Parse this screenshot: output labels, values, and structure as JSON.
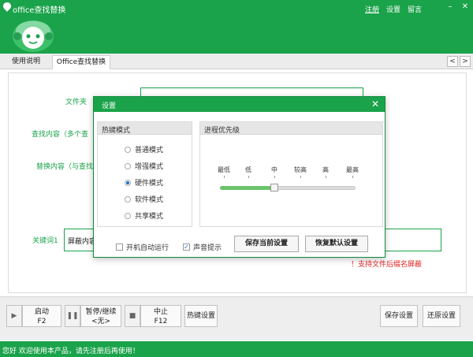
{
  "window": {
    "title": "office查找替换",
    "min_symbol": "–",
    "close_symbol": "✕"
  },
  "top_links": [
    "注册",
    "设置",
    "留言"
  ],
  "tabs": {
    "help": "使用说明",
    "replace": "Office查找替换",
    "prev": "<",
    "next": ">"
  },
  "form": {
    "folder_label": "文件夹",
    "find_label": "查找内容（多个查",
    "replace_label": "替换内容（与查找",
    "keyword_label": "关键词1",
    "keyword_value": "屏蔽内容",
    "support_note": "！支持文件后缀名屏蔽"
  },
  "dialog": {
    "title": "设置",
    "close_symbol": "✕",
    "hotkey_group": {
      "title": "热键模式",
      "options": [
        "普通模式",
        "增强模式",
        "硬件模式",
        "软件模式",
        "共享模式"
      ],
      "selected": "硬件模式"
    },
    "priority_group": {
      "title": "进程优先级",
      "levels": [
        "最低",
        "低",
        "中",
        "较高",
        "高",
        "最高"
      ],
      "selected_level": "中"
    },
    "auto_start": {
      "label": "开机自动运行",
      "checked": false
    },
    "sound": {
      "label": "声音提示",
      "checked": true
    },
    "save_current_label": "保存当前设置",
    "restore_default_label": "恢复默认设置"
  },
  "toolbar": {
    "start_icon": "▶",
    "start_label": "启动",
    "start_key": "F2",
    "pause_icon": "❚❚",
    "pause_label": "暂停/继续",
    "pause_key": "<无>",
    "stop_icon": "■",
    "stop_label": "中止",
    "stop_key": "F12",
    "hotkey_label": "热键设置",
    "save_settings_label": "保存设置",
    "restore_settings_label": "还原设置"
  },
  "status": {
    "text": "您好 欢迎使用本产品，请先注册后再使用！"
  },
  "colors": {
    "brand_green": "#1aa34a",
    "warning_red": "#e02020"
  }
}
